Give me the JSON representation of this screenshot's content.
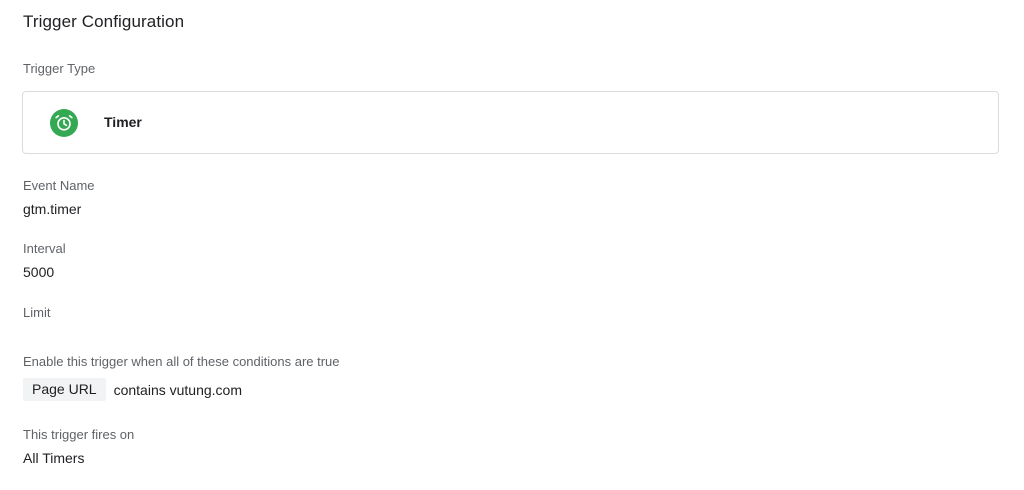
{
  "section": {
    "title": "Trigger Configuration"
  },
  "trigger_type": {
    "label": "Trigger Type",
    "name": "Timer",
    "icon": "alarm-clock-icon",
    "icon_color": "#34a853"
  },
  "event_name": {
    "label": "Event Name",
    "value": "gtm.timer"
  },
  "interval": {
    "label": "Interval",
    "value": "5000"
  },
  "limit": {
    "label": "Limit",
    "value": ""
  },
  "conditions": {
    "label": "Enable this trigger when all of these conditions are true",
    "items": [
      {
        "variable": "Page URL",
        "operator_value": "contains vutung.com"
      }
    ]
  },
  "fires_on": {
    "label": "This trigger fires on",
    "value": "All Timers"
  }
}
